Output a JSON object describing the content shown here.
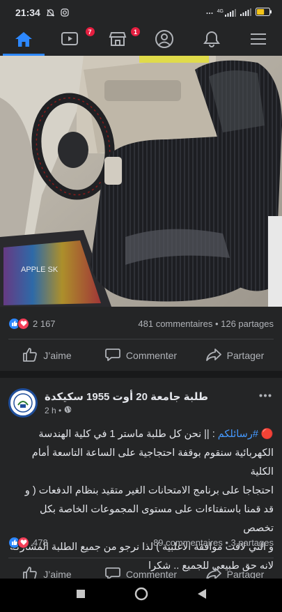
{
  "status_bar": {
    "time": "21:34",
    "network": "4G",
    "battery_level": 0.6
  },
  "nav": {
    "items": [
      {
        "name": "home",
        "icon": "home-icon",
        "active": true
      },
      {
        "name": "watch",
        "icon": "video-icon",
        "badge": "7"
      },
      {
        "name": "marketplace",
        "icon": "store-icon",
        "badge": "1"
      },
      {
        "name": "profile",
        "icon": "profile-icon"
      },
      {
        "name": "notifications",
        "icon": "bell-icon"
      },
      {
        "name": "menu",
        "icon": "hamburger-icon"
      }
    ]
  },
  "post1": {
    "photo_text": "APPLE SK",
    "reaction_count": "2 167",
    "comments_shares": "481 commentaires • 126 partages",
    "actions": {
      "like": "J’aime",
      "comment": "Commenter",
      "share": "Partager"
    }
  },
  "post2": {
    "page_name": "طلبة جامعة 20 أوت 1955 سكيكدة",
    "time": "2 h •",
    "text_lines": [
      "🔴 #رسائلكم : || نحن كل طلبة ماستر 1 في كلية الهندسة",
      "الكهربائية سنقوم بوقفة احتجاجية على الساعة التاسعة أمام الكلية",
      "احتجاجا على برنامج الامتحانات الغير متقيد بنظام الدفعات ( و",
      "قد قمنا باستفتاءات على مستوى المجموعات الخاصة بكل تخصص",
      "و التي لاقت موافقة الاغلبية ) لذا نرجو من جميع الطلبة المشاركة",
      "لانه حق طبيعي للجميع .. شكرا"
    ],
    "hashtag": "#رسائلكم",
    "reaction_count": "478",
    "comments_shares": "89 commentaires • 3 partages",
    "actions": {
      "like": "J’aime",
      "comment": "Commenter",
      "share": "Partager"
    }
  },
  "colors": {
    "background": "#18191a",
    "surface": "#242526",
    "accent": "#2d88ff",
    "badge": "#e41e3f",
    "text": "#e4e6eb",
    "secondary_text": "#b0b3b8",
    "link": "#4599ff"
  }
}
